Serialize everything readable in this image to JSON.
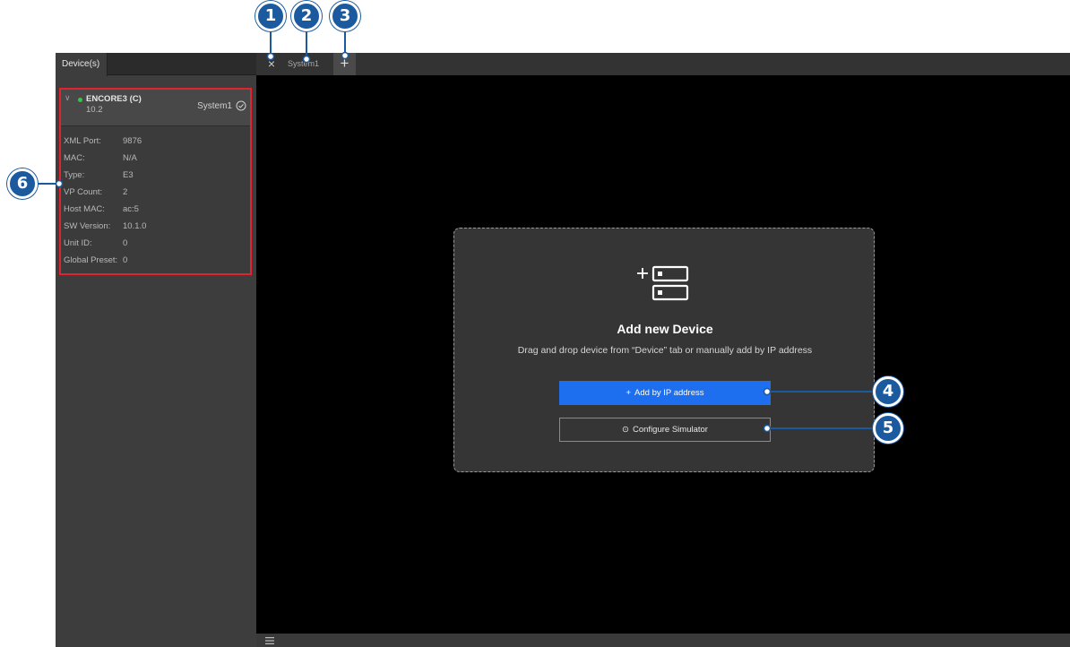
{
  "left_panel": {
    "tab_label": "Device(s)",
    "device": {
      "name": "ENCORE3 (C)",
      "ip": "10.2",
      "system": "System1",
      "properties": [
        {
          "key": "XML Port:",
          "value": "9876"
        },
        {
          "key": "MAC:",
          "value": "N/A"
        },
        {
          "key": "Type:",
          "value": "E3"
        },
        {
          "key": "VP Count:",
          "value": "2"
        },
        {
          "key": "Host MAC:",
          "value": "ac:5"
        },
        {
          "key": "SW Version:",
          "value": "10.1.0"
        },
        {
          "key": "Unit ID:",
          "value": "0"
        },
        {
          "key": "Global Preset:",
          "value": "0"
        }
      ]
    }
  },
  "tabs": {
    "close_glyph": "×",
    "system_tab_label": "System1",
    "add_glyph": "+"
  },
  "dropzone": {
    "title": "Add new Device",
    "subtitle": "Drag and drop device from “Device” tab or manually add by IP address",
    "add_ip_icon": "+",
    "add_ip_label": "Add by IP address",
    "simulator_icon": "⊙",
    "simulator_label": "Configure Simulator"
  },
  "callouts": {
    "c1": "1",
    "c2": "2",
    "c3": "3",
    "c4": "4",
    "c5": "5",
    "c6": "6"
  },
  "icons": {
    "close": "close-icon",
    "add_tab": "plus-icon",
    "add_device": "add-server-icon",
    "menu": "hamburger-menu-icon",
    "simulator": "simulator-icon",
    "status": "online-status-icon",
    "check": "check-circle-icon"
  },
  "colors": {
    "primary_button": "#1e6ff0",
    "callout": "#1b5a9e",
    "highlight_border": "#e0232e",
    "status_online": "#2ecc40"
  }
}
